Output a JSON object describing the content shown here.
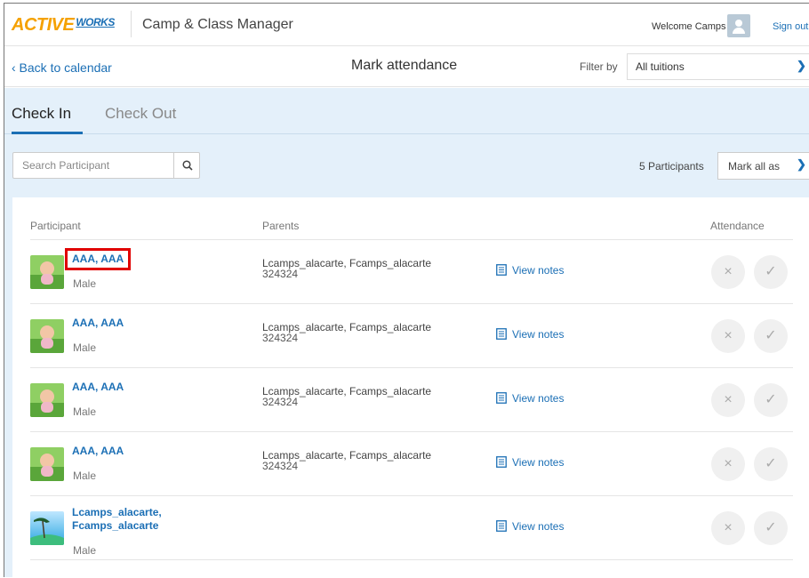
{
  "header": {
    "logo_active": "ACTIVE",
    "logo_works": "WORKS",
    "app_name": "Camp & Class Manager",
    "welcome": "Welcome Camps",
    "sign_out": "Sign out"
  },
  "subheader": {
    "back_link": "‹ Back to calendar",
    "page_title": "Mark attendance",
    "filter_label": "Filter by",
    "filter_value": "All tuitions"
  },
  "tabs": {
    "check_in": "Check In",
    "check_out": "Check Out"
  },
  "toolbar": {
    "search_placeholder": "Search Participant",
    "participant_count": "5 Participants",
    "mark_all": "Mark all as"
  },
  "table": {
    "headers": {
      "participant": "Participant",
      "parents": "Parents",
      "attendance": "Attendance"
    },
    "rows": [
      {
        "name_line1": "AAA, AAA",
        "name_line2": "",
        "gender": "Male",
        "parents": "Lcamps_alacarte, Fcamps_alacarte",
        "phone": "324324",
        "notes": "View notes",
        "avatar": "baby-photo",
        "highlighted": true
      },
      {
        "name_line1": "AAA, AAA",
        "name_line2": "",
        "gender": "Male",
        "parents": "Lcamps_alacarte, Fcamps_alacarte",
        "phone": "324324",
        "notes": "View notes",
        "avatar": "baby-photo",
        "highlighted": false
      },
      {
        "name_line1": "AAA, AAA",
        "name_line2": "",
        "gender": "Male",
        "parents": "Lcamps_alacarte, Fcamps_alacarte",
        "phone": "324324",
        "notes": "View notes",
        "avatar": "baby-photo",
        "highlighted": false
      },
      {
        "name_line1": "AAA, AAA",
        "name_line2": "",
        "gender": "Male",
        "parents": "Lcamps_alacarte, Fcamps_alacarte",
        "phone": "324324",
        "notes": "View notes",
        "avatar": "baby-photo",
        "highlighted": false
      },
      {
        "name_line1": "Lcamps_alacarte,",
        "name_line2": "Fcamps_alacarte",
        "gender": "Male",
        "parents": "",
        "phone": "",
        "notes": "View notes",
        "avatar": "beach-photo",
        "highlighted": false
      }
    ]
  },
  "icons": {
    "absent": "×",
    "present": "✓",
    "chevron": "❯"
  },
  "colors": {
    "accent": "#1b6fb5",
    "highlight_box": "#e00000",
    "panel_bg": "#e4f0fa"
  }
}
